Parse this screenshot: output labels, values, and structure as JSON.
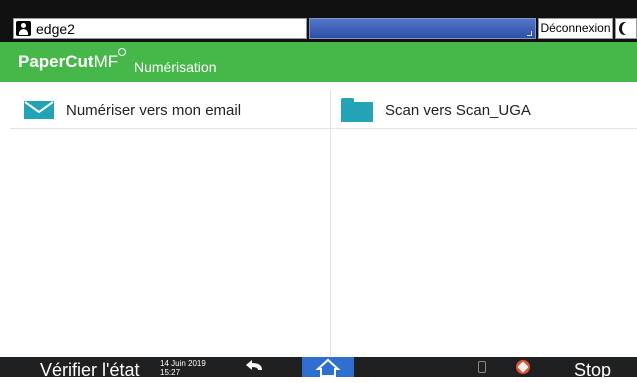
{
  "topbar": {
    "username": "edge2",
    "logout_label": "Déconnexion"
  },
  "header": {
    "brand_main": "PaperCut",
    "brand_suffix": "MF",
    "section_title": "Numérisation"
  },
  "options": [
    {
      "label": "Numériser vers mon email",
      "icon": "mail-icon"
    },
    {
      "label": "Scan vers Scan_UGA",
      "icon": "folder-icon"
    }
  ],
  "bottombar": {
    "check_status_label": "Vérifier l'état",
    "date": "14 Juin 2019",
    "time": "15:27",
    "stop_label": "Stop"
  },
  "colors": {
    "header_green": "#46b84a",
    "icon_teal": "#23a3b6",
    "home_blue": "#2f6fd0",
    "stop_orange": "#e4512f"
  }
}
